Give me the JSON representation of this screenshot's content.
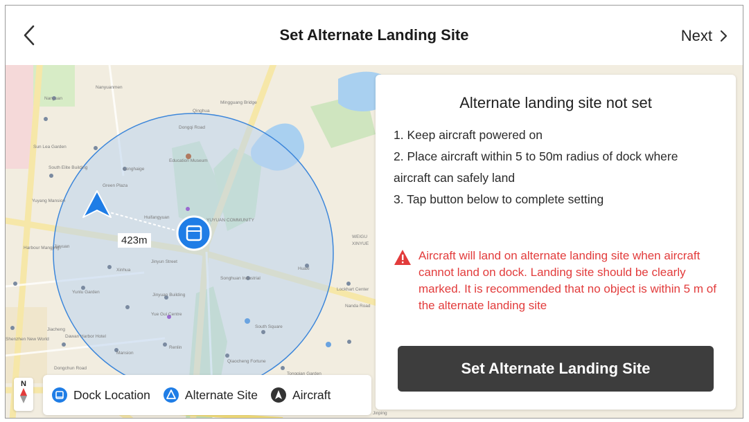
{
  "header": {
    "title": "Set Alternate Landing Site",
    "next_label": "Next"
  },
  "panel": {
    "title": "Alternate landing site not set",
    "steps": [
      "1. Keep aircraft powered on",
      "2. Place aircraft within 5 to 50m radius of dock where",
      "aircraft can safely land",
      "3. Tap button below to complete setting"
    ],
    "warning": "Aircraft will land on alternate landing site when aircraft cannot land on dock. Landing site should be clearly marked. It is recommended that no object is within 5 m of the alternate landing site",
    "button_label": "Set Alternate Landing Site"
  },
  "map": {
    "distance_label": "423m",
    "compass_label": "N"
  },
  "legend": {
    "dock": "Dock Location",
    "alternate": "Alternate Site",
    "aircraft": "Aircraft"
  },
  "colors": {
    "accent_blue": "#1f7de6",
    "warning_red": "#e23b3b",
    "button_dark": "#3d3d3d",
    "radius_fill": "#bcd3ee"
  },
  "icons": {
    "back": "chevron-left-icon",
    "next": "chevron-right-icon",
    "warning": "warning-triangle-icon",
    "dock": "dock-icon",
    "aircraft": "aircraft-arrow-icon"
  }
}
